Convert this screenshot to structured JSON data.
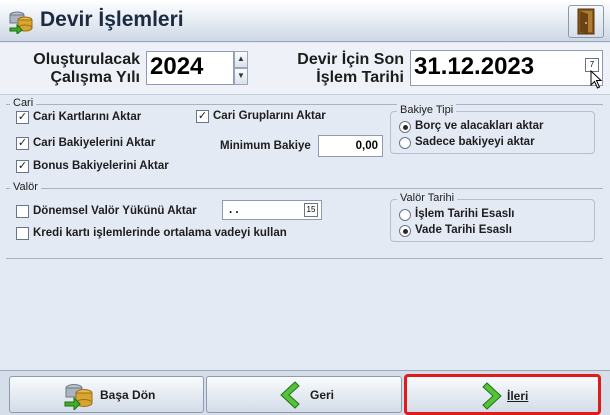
{
  "window": {
    "title": "Devir İşlemleri"
  },
  "header": {
    "year_label": "Oluşturulacak Çalışma Yılı",
    "year_label_line1": "Oluşturulacak",
    "year_label_line2": "Çalışma Yılı",
    "year_value": "2024",
    "date_label_line1": "Devir İçin Son",
    "date_label_line2": "İşlem Tarihi",
    "date_value": "31.12.2023"
  },
  "cari": {
    "title": "Cari",
    "cb_kartlar": "Cari Kartlarını Aktar",
    "cb_gruplar": "Cari Gruplarını Aktar",
    "cb_bakiyeler": "Cari Bakiyelerini Aktar",
    "cb_bonus": "Bonus Bakiyelerini Aktar",
    "min_bakiye_label": "Minimum Bakiye",
    "min_bakiye_value": "0,00",
    "bakiye_tipi": {
      "title": "Bakiye Tipi",
      "opt1": "Borç ve alacakları aktar",
      "opt2": "Sadece bakiyeyi aktar"
    }
  },
  "valor": {
    "title": "Valör",
    "cb_donemsel": "Dönemsel Valör Yükünü Aktar",
    "date_value": " .  .",
    "cb_kredi": "Kredi kartı işlemlerinde ortalama vadeyi kullan",
    "valor_tarihi": {
      "title": "Valör Tarihi",
      "opt1": "İşlem Tarihi Esaslı",
      "opt2": "Vade Tarihi Esaslı"
    }
  },
  "bottom": {
    "basa_don": "Başa Dön",
    "geri": "Geri",
    "ileri": "İleri"
  },
  "colors": {
    "active_border": "#e01b1b",
    "arrow_green": "#3fae2a"
  }
}
